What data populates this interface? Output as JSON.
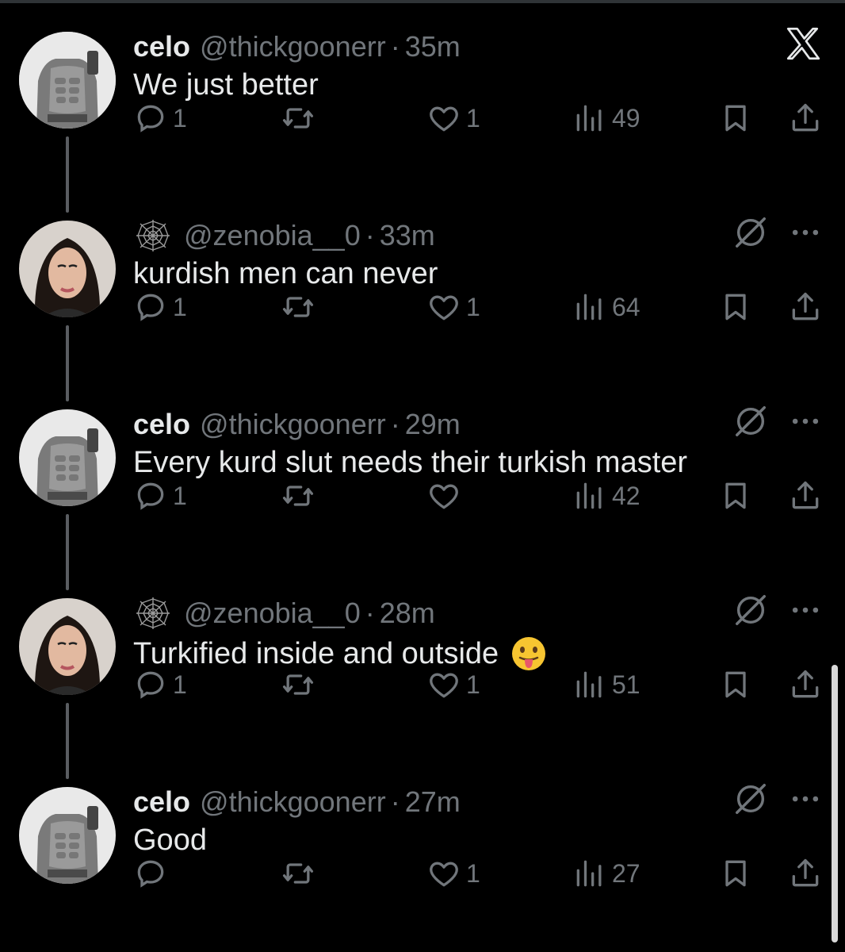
{
  "tweets": [
    {
      "name": "celo",
      "handle": "@thickgoonerr",
      "time": "35m",
      "text": "We just better",
      "replies": "1",
      "retweets": "",
      "likes": "1",
      "views": "49",
      "avatar": "celo"
    },
    {
      "name": "",
      "handle": "@zenobia__0",
      "time": "33m",
      "text": "kurdish men can never",
      "replies": "1",
      "retweets": "",
      "likes": "1",
      "views": "64",
      "avatar": "zenobia"
    },
    {
      "name": "celo",
      "handle": "@thickgoonerr",
      "time": "29m",
      "text": "Every kurd slut needs their turkish master",
      "replies": "1",
      "retweets": "",
      "likes": "",
      "views": "42",
      "avatar": "celo"
    },
    {
      "name": "",
      "handle": "@zenobia__0",
      "time": "28m",
      "text": "Turkified inside and outside",
      "emoji": "tongue-out-emoji",
      "replies": "1",
      "retweets": "",
      "likes": "1",
      "views": "51",
      "avatar": "zenobia"
    },
    {
      "name": "celo",
      "handle": "@thickgoonerr",
      "time": "27m",
      "text": "Good",
      "replies": "",
      "retweets": "",
      "likes": "1",
      "views": "27",
      "avatar": "celo"
    }
  ],
  "dot_separator": "·",
  "colors": {
    "background": "#000000",
    "text": "#e7e9ea",
    "muted": "#71767b",
    "thread_line": "#5a5d61"
  }
}
